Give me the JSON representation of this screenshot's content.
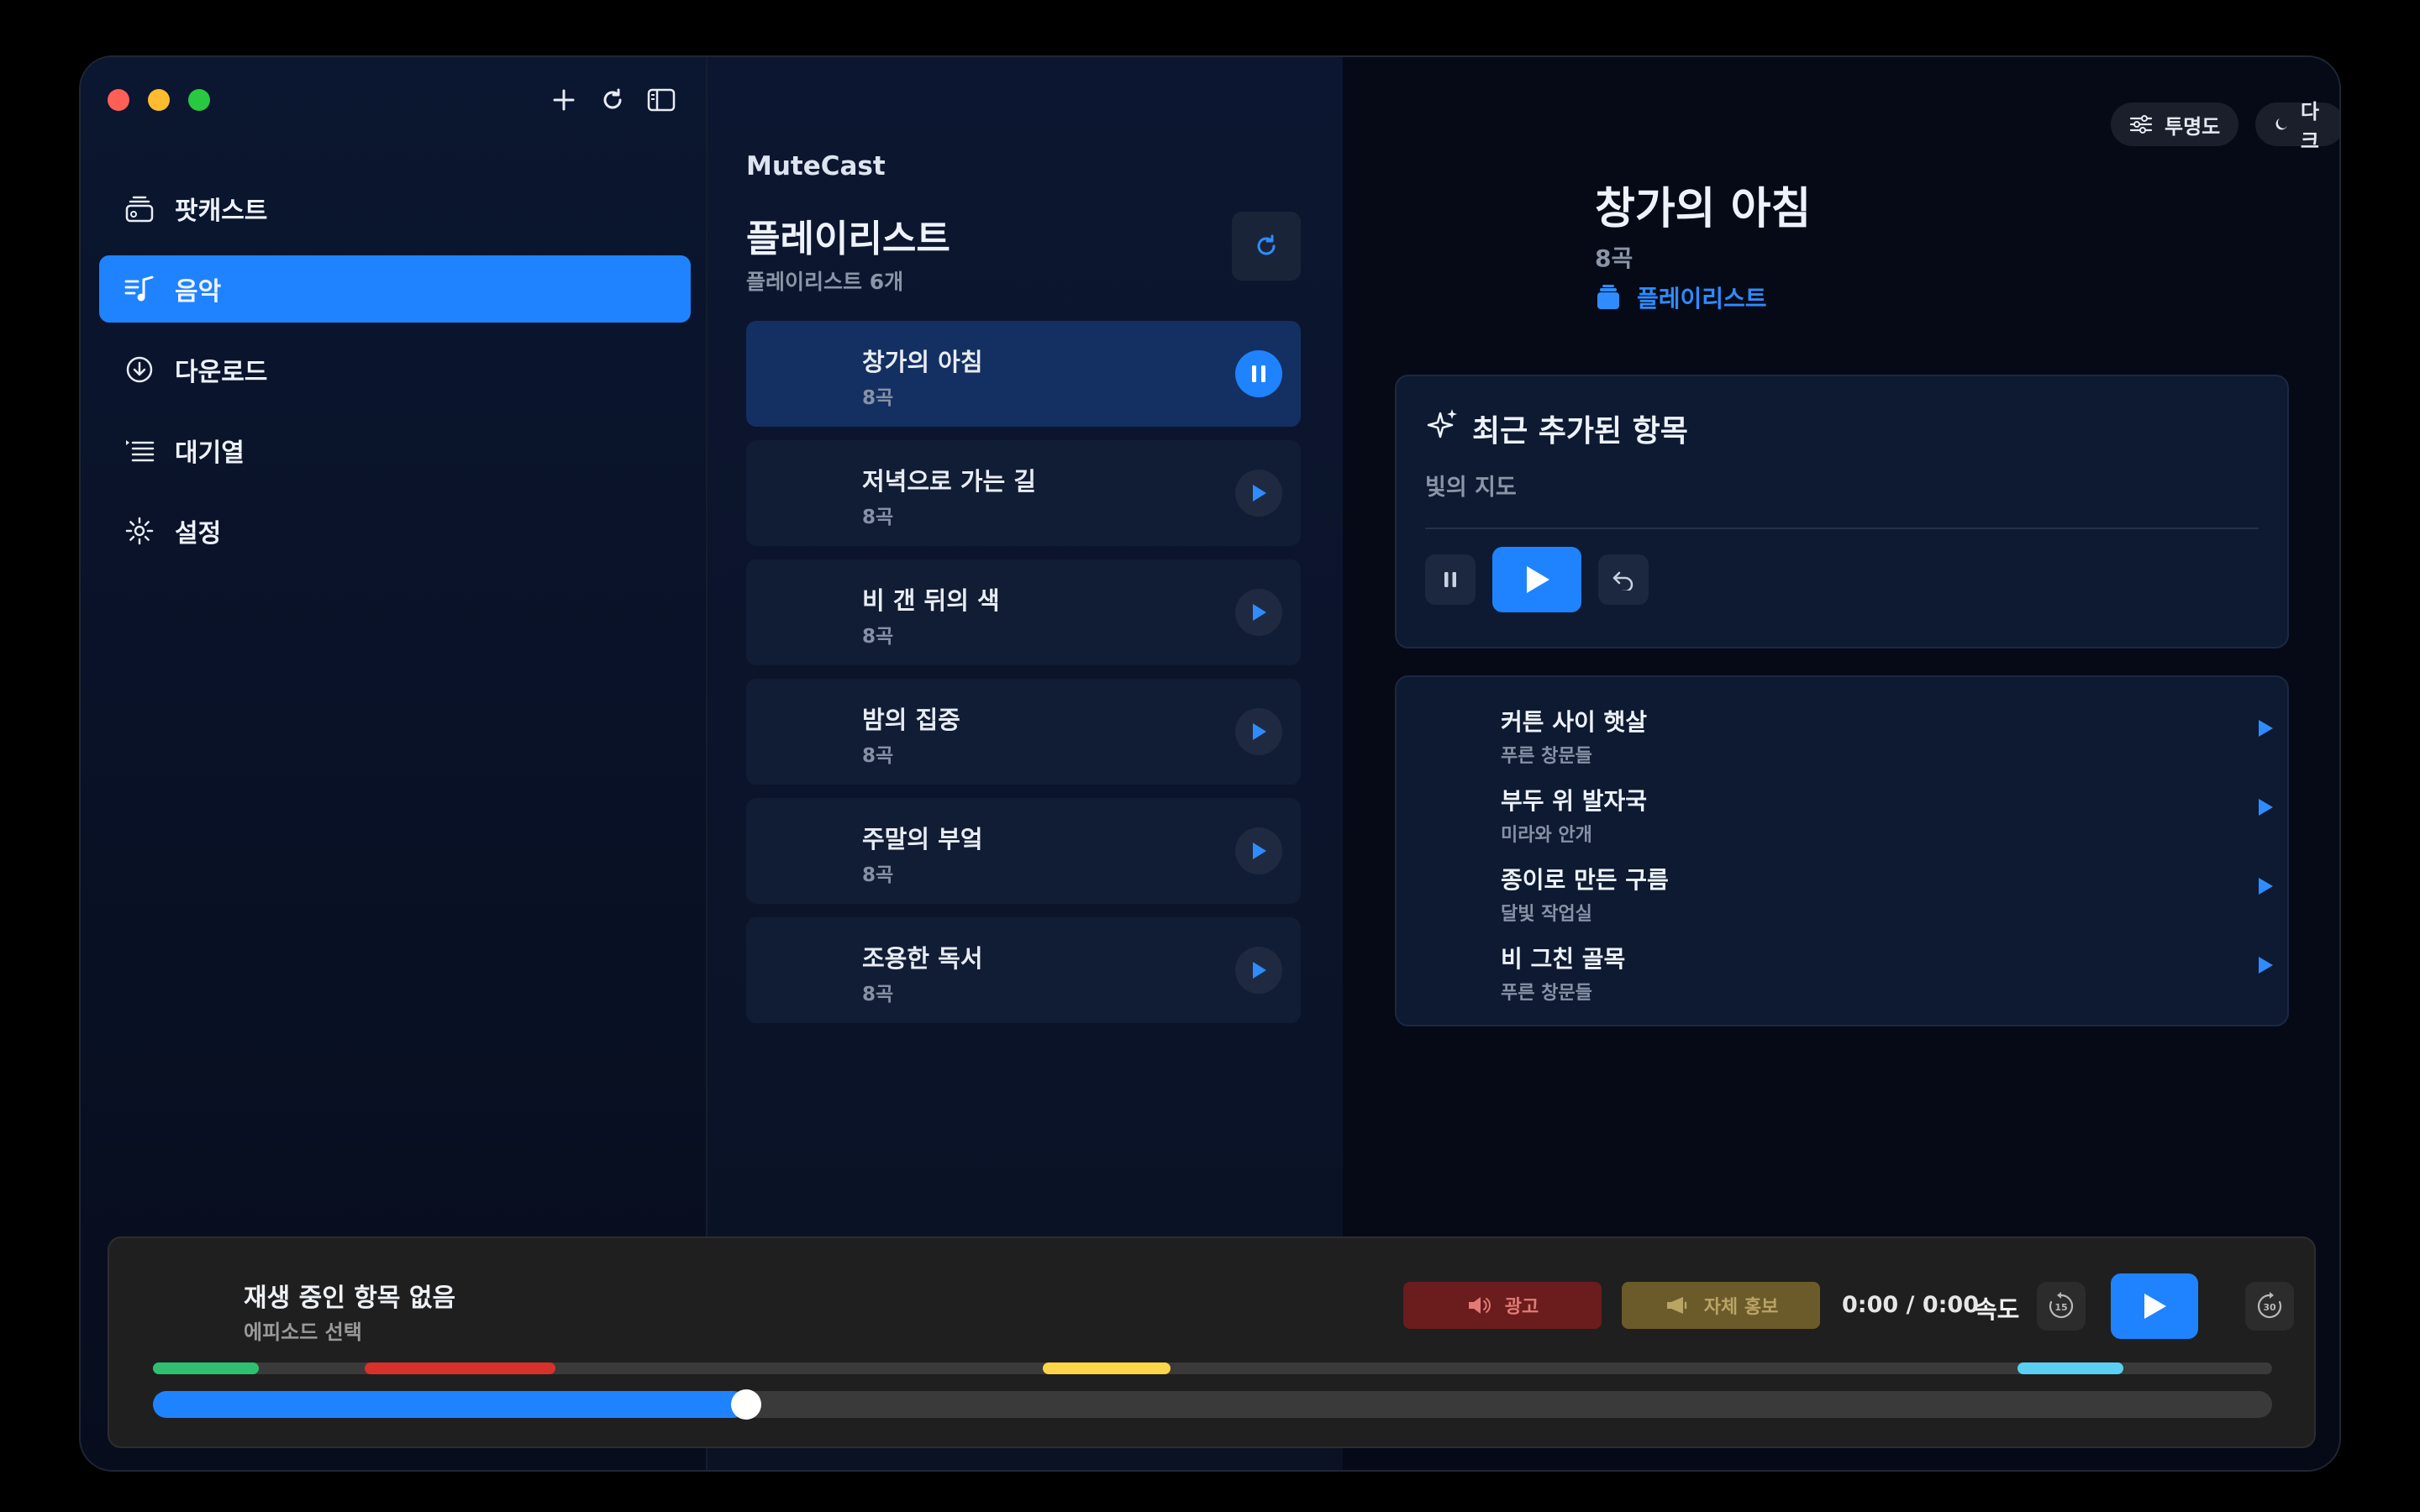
{
  "sidebar": {
    "items": [
      {
        "label": "팟캐스트",
        "icon": "podcast-icon",
        "active": false
      },
      {
        "label": "음악",
        "icon": "music-icon",
        "active": true
      },
      {
        "label": "다운로드",
        "icon": "download-icon",
        "active": false
      },
      {
        "label": "대기열",
        "icon": "queue-icon",
        "active": false
      },
      {
        "label": "설정",
        "icon": "settings-icon",
        "active": false
      }
    ]
  },
  "middle": {
    "brand": "MuteCast",
    "title": "플레이리스트",
    "count": "플레이리스트 6개",
    "playlists": [
      {
        "name": "창가의 아침",
        "sub": "8곡",
        "playing": true
      },
      {
        "name": "저녁으로 가는 길",
        "sub": "8곡",
        "playing": false
      },
      {
        "name": "비 갠 뒤의 색",
        "sub": "8곡",
        "playing": false
      },
      {
        "name": "밤의 집중",
        "sub": "8곡",
        "playing": false
      },
      {
        "name": "주말의 부엌",
        "sub": "8곡",
        "playing": false
      },
      {
        "name": "조용한 독서",
        "sub": "8곡",
        "playing": false
      }
    ]
  },
  "header": {
    "transparency_label": "투명도",
    "dark_label": "다크"
  },
  "detail": {
    "title": "창가의 아침",
    "sub": "8곡",
    "link": "플레이리스트"
  },
  "recent": {
    "title": "최근 추가된 항목",
    "sub": "빛의 지도"
  },
  "tracks": [
    {
      "name": "커튼 사이 햇살",
      "artist": "푸른 창문들"
    },
    {
      "name": "부두 위 발자국",
      "artist": "미라와 안개"
    },
    {
      "name": "종이로 만든 구름",
      "artist": "달빛 작업실"
    },
    {
      "name": "비 그친 골목",
      "artist": "푸른 창문들"
    }
  ],
  "player": {
    "title": "재생 중인 항목 없음",
    "sub": "에피소드 선택",
    "ad_label": "광고",
    "promo_label": "자체 홍보",
    "time": "0:00 / 0:00",
    "speed_label": "속도",
    "skip_back": "15",
    "skip_forward": "30",
    "progress": 0.28,
    "segments": [
      {
        "start": 0.0,
        "end": 0.05,
        "color": "#2fbf71"
      },
      {
        "start": 0.1,
        "end": 0.19,
        "color": "#d8312c"
      },
      {
        "start": 0.42,
        "end": 0.48,
        "color": "#ffd54a"
      },
      {
        "start": 0.88,
        "end": 0.93,
        "color": "#5ad0f5"
      }
    ]
  },
  "colors": {
    "accent": "#1f83ff"
  }
}
